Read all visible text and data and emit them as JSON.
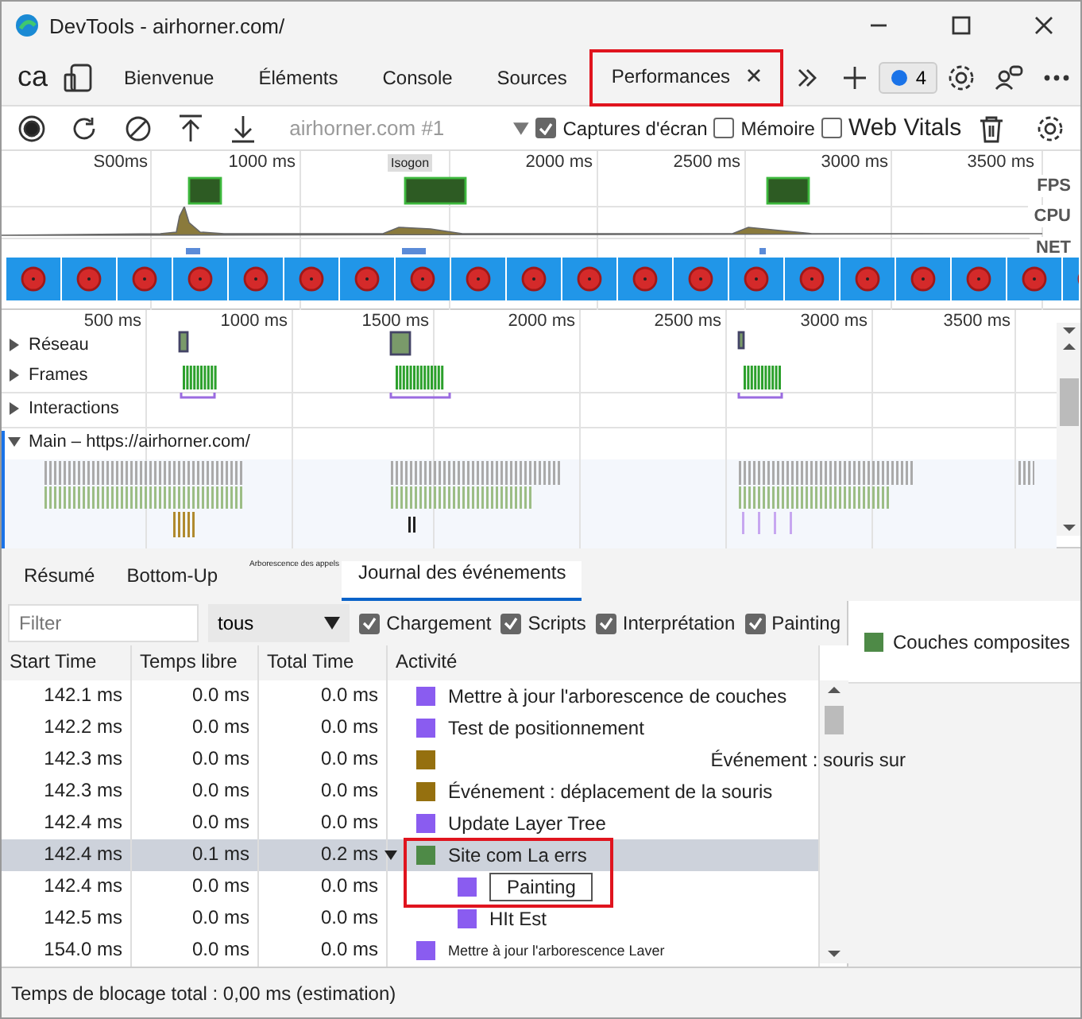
{
  "window": {
    "title": "DevTools - airhorner.com/"
  },
  "tabs": [
    {
      "label": "ca",
      "kind": "cut",
      "selected": false
    },
    {
      "label": "Bienvenue",
      "kind": "tab",
      "selected": false
    },
    {
      "label": "Éléments",
      "kind": "tab",
      "selected": false
    },
    {
      "label": "Console",
      "kind": "tab",
      "selected": false
    },
    {
      "label": "Sources",
      "kind": "tab",
      "selected": false
    },
    {
      "label": "Performances",
      "kind": "tab",
      "selected": true,
      "highlighted": true
    }
  ],
  "issues_badge": "4",
  "toolbar": {
    "recording": "airhorner.com #1",
    "checkboxes": [
      {
        "label": "Captures d'écran",
        "checked": true
      },
      {
        "label": "Mémoire",
        "checked": false
      },
      {
        "label": "Web Vitals",
        "checked": false
      }
    ]
  },
  "overview": {
    "ticks": [
      "S00ms",
      "1000 ms",
      "2000 ms",
      "2500 ms",
      "3000 ms",
      "3500 ms"
    ],
    "marker": "Isogon",
    "lanes": [
      "FPS",
      "CPU",
      "NET"
    ]
  },
  "timeline": {
    "ticks": [
      "500 ms",
      "1000 ms",
      "1500 ms",
      "2000 ms",
      "2500 ms",
      "3000 ms",
      "3500 ms"
    ],
    "tracks": [
      {
        "label": "Réseau",
        "expanded": false
      },
      {
        "label": "Frames",
        "expanded": false
      },
      {
        "label": "Interactions",
        "expanded": false
      },
      {
        "label": "Main – https://airhorner.com/",
        "expanded": true
      }
    ]
  },
  "bottom_tabs": [
    {
      "label": "Résumé",
      "selected": false,
      "kind": "normal"
    },
    {
      "label": "Bottom-Up",
      "selected": false,
      "kind": "normal"
    },
    {
      "label": "Arborescence des appels",
      "selected": false,
      "kind": "tiny"
    },
    {
      "label": "Journal des événements",
      "selected": true,
      "kind": "normal"
    }
  ],
  "filter": {
    "placeholder": "Filter",
    "select": "tous",
    "checkboxes": [
      {
        "label": "Chargement",
        "checked": true
      },
      {
        "label": "Scripts",
        "checked": true
      },
      {
        "label": "Interprétation",
        "checked": true
      },
      {
        "label": "Painting",
        "checked": true
      }
    ]
  },
  "table": {
    "columns": [
      "Start Time",
      "Temps libre",
      "Total Time",
      "Activité"
    ],
    "rows": [
      {
        "start": "142.1 ms",
        "self": "0.0 ms",
        "total": "0.0 ms",
        "activity": "Mettre à jour l'arborescence de couches",
        "color": "#8a5cf0",
        "selected": false
      },
      {
        "start": "142.2 ms",
        "self": "0.0 ms",
        "total": "0.0 ms",
        "activity": "Test de positionnement",
        "color": "#8a5cf0",
        "selected": false
      },
      {
        "start": "142.3 ms",
        "self": "0.0 ms",
        "total": "0.0 ms",
        "activity": "Événement : souris sur",
        "color": "#95700f",
        "selected": false,
        "far": true
      },
      {
        "start": "142.3 ms",
        "self": "0.0 ms",
        "total": "0.0 ms",
        "activity": "Événement : déplacement de la souris",
        "color": "#95700f",
        "selected": false
      },
      {
        "start": "142.4 ms",
        "self": "0.0 ms",
        "total": "0.0 ms",
        "activity": "Update Layer Tree",
        "color": "#8a5cf0",
        "selected": false
      },
      {
        "start": "142.4 ms",
        "self": "0.1 ms",
        "total": "0.2 ms",
        "activity": "Site com La errs",
        "color": "#4e8a47",
        "selected": true,
        "expanded": true,
        "highlighted": true,
        "children": [
          {
            "start": "142.4 ms",
            "self": "0.0 ms",
            "total": "0.0 ms",
            "tooltip": "Painting",
            "color": "#8a5cf0",
            "selected": false
          },
          {
            "start": "142.5 ms",
            "self": "0.0 ms",
            "total": "0.0 ms",
            "activity": "HIt Est",
            "color": "#8a5cf0",
            "selected": false
          }
        ]
      },
      {
        "start": "154.0 ms",
        "self": "0.0 ms",
        "total": "0.0 ms",
        "activity": "Mettre à jour l'arborescence Laver",
        "color": "#8a5cf0",
        "selected": false,
        "small": true
      }
    ]
  },
  "details": {
    "category": "Couches composites",
    "color": "#4e8a47"
  },
  "status_bar": "Temps de blocage total : 0,00 ms (estimation)"
}
